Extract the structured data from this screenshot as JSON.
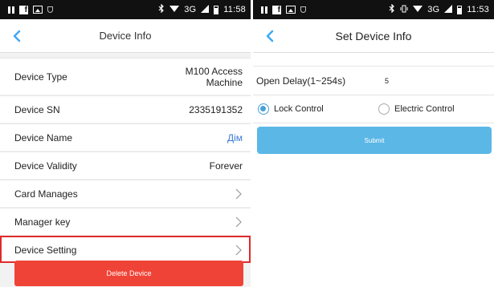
{
  "left_screen": {
    "status": {
      "network": "3G",
      "time": "11:58"
    },
    "title": "Device Info",
    "rows": [
      {
        "label": "Device Type",
        "value": "M100 Access Machine"
      },
      {
        "label": "Device SN",
        "value": "2335191352"
      },
      {
        "label": "Device Name",
        "value": "Дім"
      },
      {
        "label": "Device Validity",
        "value": "Forever"
      },
      {
        "label": "Card Manages",
        "value": ""
      },
      {
        "label": "Manager key",
        "value": ""
      },
      {
        "label": "Device Setting",
        "value": ""
      }
    ],
    "delete_label": "Delete Device",
    "colors": {
      "highlight": "#e02a2a",
      "delete": "#f04337",
      "link": "#3a7bd5",
      "back": "#3fa9f5"
    }
  },
  "right_screen": {
    "status": {
      "network": "3G",
      "time": "11:53"
    },
    "title": "Set Device Info",
    "open_delay_label": "Open Delay(1~254s)",
    "open_delay_value": "5",
    "radio_options": [
      {
        "label": "Lock Control",
        "checked": true
      },
      {
        "label": "Electric Control",
        "checked": false
      }
    ],
    "submit_label": "Submit",
    "colors": {
      "submit": "#5bb7e6",
      "radio": "#4a9fd8"
    }
  }
}
